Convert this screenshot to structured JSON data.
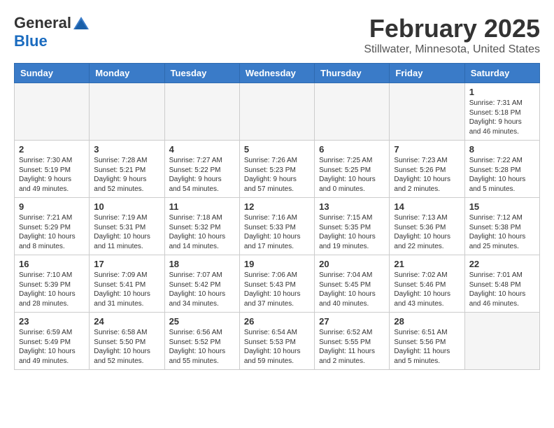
{
  "header": {
    "logo_general": "General",
    "logo_blue": "Blue",
    "month_title": "February 2025",
    "location": "Stillwater, Minnesota, United States"
  },
  "days_of_week": [
    "Sunday",
    "Monday",
    "Tuesday",
    "Wednesday",
    "Thursday",
    "Friday",
    "Saturday"
  ],
  "weeks": [
    [
      {
        "day": "",
        "info": ""
      },
      {
        "day": "",
        "info": ""
      },
      {
        "day": "",
        "info": ""
      },
      {
        "day": "",
        "info": ""
      },
      {
        "day": "",
        "info": ""
      },
      {
        "day": "",
        "info": ""
      },
      {
        "day": "1",
        "info": "Sunrise: 7:31 AM\nSunset: 5:18 PM\nDaylight: 9 hours and 46 minutes."
      }
    ],
    [
      {
        "day": "2",
        "info": "Sunrise: 7:30 AM\nSunset: 5:19 PM\nDaylight: 9 hours and 49 minutes."
      },
      {
        "day": "3",
        "info": "Sunrise: 7:28 AM\nSunset: 5:21 PM\nDaylight: 9 hours and 52 minutes."
      },
      {
        "day": "4",
        "info": "Sunrise: 7:27 AM\nSunset: 5:22 PM\nDaylight: 9 hours and 54 minutes."
      },
      {
        "day": "5",
        "info": "Sunrise: 7:26 AM\nSunset: 5:23 PM\nDaylight: 9 hours and 57 minutes."
      },
      {
        "day": "6",
        "info": "Sunrise: 7:25 AM\nSunset: 5:25 PM\nDaylight: 10 hours and 0 minutes."
      },
      {
        "day": "7",
        "info": "Sunrise: 7:23 AM\nSunset: 5:26 PM\nDaylight: 10 hours and 2 minutes."
      },
      {
        "day": "8",
        "info": "Sunrise: 7:22 AM\nSunset: 5:28 PM\nDaylight: 10 hours and 5 minutes."
      }
    ],
    [
      {
        "day": "9",
        "info": "Sunrise: 7:21 AM\nSunset: 5:29 PM\nDaylight: 10 hours and 8 minutes."
      },
      {
        "day": "10",
        "info": "Sunrise: 7:19 AM\nSunset: 5:31 PM\nDaylight: 10 hours and 11 minutes."
      },
      {
        "day": "11",
        "info": "Sunrise: 7:18 AM\nSunset: 5:32 PM\nDaylight: 10 hours and 14 minutes."
      },
      {
        "day": "12",
        "info": "Sunrise: 7:16 AM\nSunset: 5:33 PM\nDaylight: 10 hours and 17 minutes."
      },
      {
        "day": "13",
        "info": "Sunrise: 7:15 AM\nSunset: 5:35 PM\nDaylight: 10 hours and 19 minutes."
      },
      {
        "day": "14",
        "info": "Sunrise: 7:13 AM\nSunset: 5:36 PM\nDaylight: 10 hours and 22 minutes."
      },
      {
        "day": "15",
        "info": "Sunrise: 7:12 AM\nSunset: 5:38 PM\nDaylight: 10 hours and 25 minutes."
      }
    ],
    [
      {
        "day": "16",
        "info": "Sunrise: 7:10 AM\nSunset: 5:39 PM\nDaylight: 10 hours and 28 minutes."
      },
      {
        "day": "17",
        "info": "Sunrise: 7:09 AM\nSunset: 5:41 PM\nDaylight: 10 hours and 31 minutes."
      },
      {
        "day": "18",
        "info": "Sunrise: 7:07 AM\nSunset: 5:42 PM\nDaylight: 10 hours and 34 minutes."
      },
      {
        "day": "19",
        "info": "Sunrise: 7:06 AM\nSunset: 5:43 PM\nDaylight: 10 hours and 37 minutes."
      },
      {
        "day": "20",
        "info": "Sunrise: 7:04 AM\nSunset: 5:45 PM\nDaylight: 10 hours and 40 minutes."
      },
      {
        "day": "21",
        "info": "Sunrise: 7:02 AM\nSunset: 5:46 PM\nDaylight: 10 hours and 43 minutes."
      },
      {
        "day": "22",
        "info": "Sunrise: 7:01 AM\nSunset: 5:48 PM\nDaylight: 10 hours and 46 minutes."
      }
    ],
    [
      {
        "day": "23",
        "info": "Sunrise: 6:59 AM\nSunset: 5:49 PM\nDaylight: 10 hours and 49 minutes."
      },
      {
        "day": "24",
        "info": "Sunrise: 6:58 AM\nSunset: 5:50 PM\nDaylight: 10 hours and 52 minutes."
      },
      {
        "day": "25",
        "info": "Sunrise: 6:56 AM\nSunset: 5:52 PM\nDaylight: 10 hours and 55 minutes."
      },
      {
        "day": "26",
        "info": "Sunrise: 6:54 AM\nSunset: 5:53 PM\nDaylight: 10 hours and 59 minutes."
      },
      {
        "day": "27",
        "info": "Sunrise: 6:52 AM\nSunset: 5:55 PM\nDaylight: 11 hours and 2 minutes."
      },
      {
        "day": "28",
        "info": "Sunrise: 6:51 AM\nSunset: 5:56 PM\nDaylight: 11 hours and 5 minutes."
      },
      {
        "day": "",
        "info": ""
      }
    ]
  ]
}
